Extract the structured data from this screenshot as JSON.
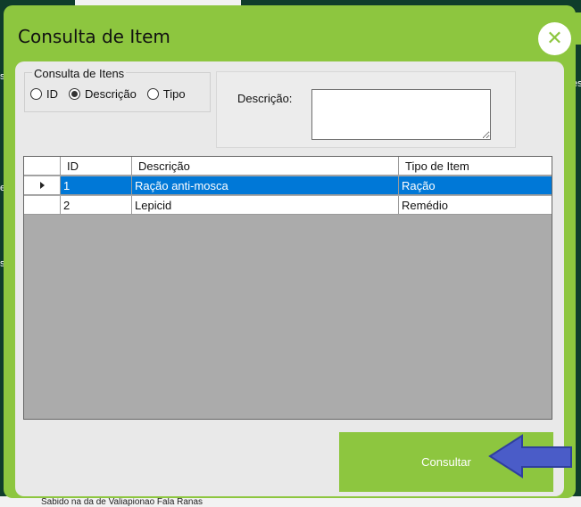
{
  "background": {
    "left_snippets": [
      "s",
      "e",
      "s"
    ],
    "right_snippet": "es",
    "bottom_snippet": "Sabido na da de Valiapionao Fala Ranas"
  },
  "dialog": {
    "title": "Consulta de Item",
    "close_icon": "close-icon",
    "accent_color": "#8dc63f"
  },
  "group": {
    "legend": "Consulta de Itens",
    "options": [
      {
        "label": "ID",
        "selected": false
      },
      {
        "label": "Descrição",
        "selected": true
      },
      {
        "label": "Tipo",
        "selected": false
      }
    ]
  },
  "search": {
    "label": "Descrição:",
    "value": ""
  },
  "grid": {
    "columns": [
      "ID",
      "Descrição",
      "Tipo de Item"
    ],
    "rows": [
      {
        "id": "1",
        "descricao": "Ração anti-mosca",
        "tipo": "Ração",
        "selected": true
      },
      {
        "id": "2",
        "descricao": "Lepicid",
        "tipo": "Remédio",
        "selected": false
      }
    ]
  },
  "actions": {
    "consultar_label": "Consultar",
    "arrow_icon": "arrow-left-icon",
    "arrow_color": "#4a5cc8"
  }
}
